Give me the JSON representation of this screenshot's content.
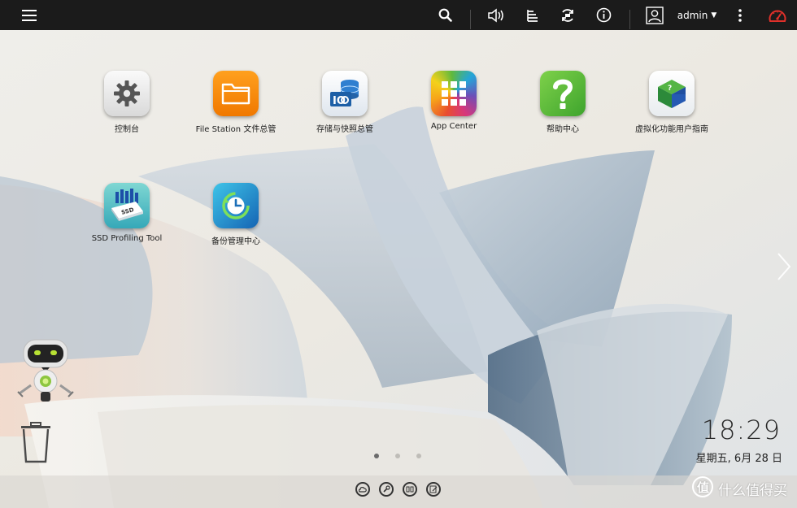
{
  "topbar": {
    "menu_icon": "hamburger-menu-icon",
    "search_icon": "search-icon",
    "volume_icon": "volume-icon",
    "tasks_icon": "background-tasks-icon",
    "sync_icon": "external-device-sync-icon",
    "info_icon": "info-icon",
    "user_icon": "user-avatar-icon",
    "username": "admin",
    "more_icon": "more-options-icon",
    "dashboard_icon": "dashboard-gauge-icon"
  },
  "desktop": {
    "apps": [
      {
        "label": "控制台",
        "icon": "control-panel-gear-icon"
      },
      {
        "label": "File Station 文件总管",
        "icon": "file-station-folder-icon"
      },
      {
        "label": "存储与快照总管",
        "icon": "storage-snapshots-icon"
      },
      {
        "label": "App Center",
        "icon": "app-center-grid-icon"
      },
      {
        "label": "帮助中心",
        "icon": "help-center-question-icon"
      },
      {
        "label": "虚拟化功能用户指南",
        "icon": "virtualization-guide-cube-icon"
      },
      {
        "label": "SSD Profiling Tool",
        "icon": "ssd-profiling-tool-icon"
      },
      {
        "label": "备份管理中心",
        "icon": "backup-manager-clock-icon"
      }
    ]
  },
  "clock": {
    "time": "18:29",
    "date": "星期五, 6月 28 日"
  },
  "pager": {
    "pages": 3,
    "active": 1
  },
  "dock": {
    "items": [
      "dock-cloud-icon",
      "dock-tools-icon",
      "dock-apps-icon",
      "dock-notes-icon"
    ]
  },
  "watermark": {
    "text": "什么值得买"
  },
  "colors": {
    "topbar": "#1b1b1b",
    "accent_red": "#e0302a"
  }
}
